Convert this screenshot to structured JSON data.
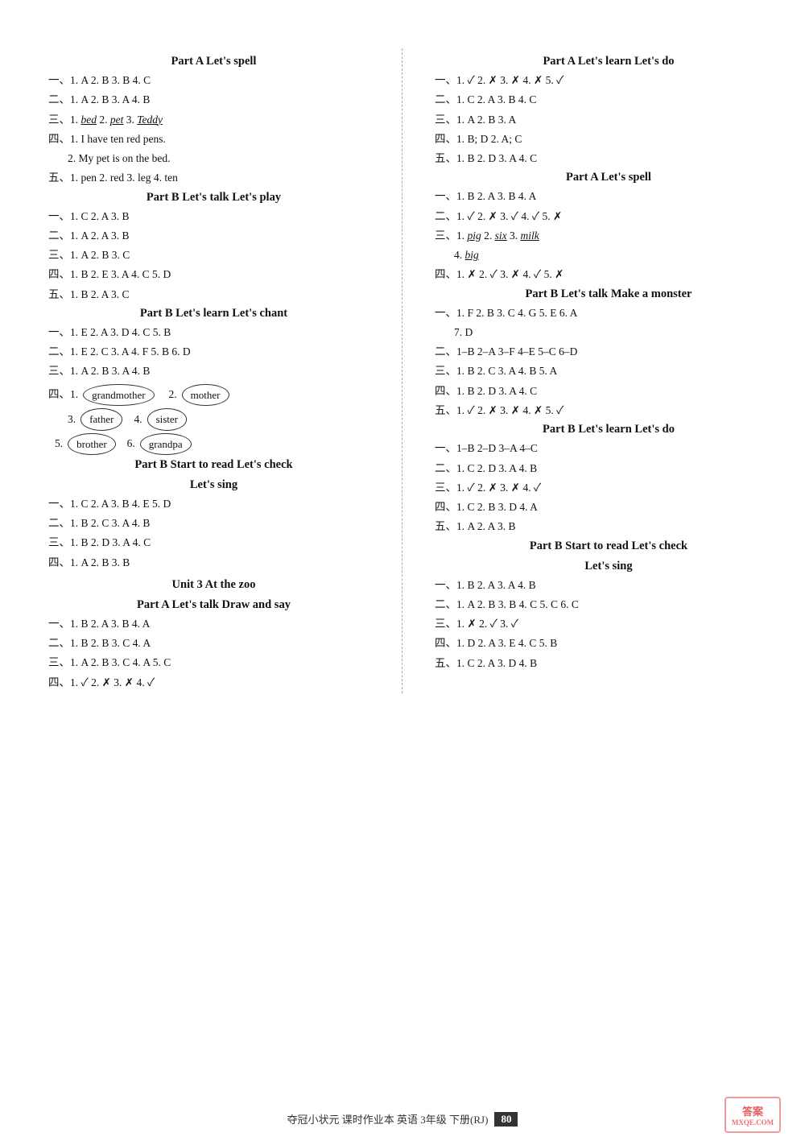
{
  "left": {
    "sections": [
      {
        "title": "Part A  Let's spell",
        "lines": [
          "一、1. A  2. B  3. B  4. C",
          "二、1. A  2. B  3. A  4. B",
          "三、1. <u>bed</u>  2. <u>pet</u>  3. <u>Teddy</u>",
          "四、1. I have ten red pens.",
          "  2. My pet is on the bed.",
          "五、1. pen  2. red  3. leg  4. ten"
        ]
      },
      {
        "title": "Part B  Let's talk  Let's play",
        "lines": [
          "一、1. C  2. A  3. B",
          "二、1. A  2. A  3. B",
          "三、1. A  2. B  3. C",
          "四、1. B  2. E  3. A  4. C  5. D",
          "五、1. B  2. A  3. C"
        ]
      },
      {
        "title": "Part B  Let's learn  Let's chant",
        "lines": [
          "一、1. E  2. A  3. D  4. C  5. B",
          "二、1. E  2. C  3. A  4. F  5. B  6. D",
          "三、1. A  2. B  3. A  4. B"
        ]
      },
      {
        "oval_section": true,
        "items": [
          {
            "num": "四、1.",
            "word": "grandmother"
          },
          {
            "num": "2.",
            "word": "mother"
          },
          {
            "num": "3.",
            "word": "father"
          },
          {
            "num": "4.",
            "word": "sister"
          },
          {
            "num": "5.",
            "word": "brother"
          },
          {
            "num": "6.",
            "word": "grandpa"
          }
        ]
      },
      {
        "title": "Part B  Start to read  Let's check",
        "subtitle": "Let's sing",
        "lines": [
          "一、1. C  2. A  3. B  4. E  5. D",
          "二、1. B  2. C  3. A  4. B",
          "三、1. B  2. D  3. A  4. C",
          "四、1. A  2. B  3. B"
        ]
      },
      {
        "title": "Unit 3  At the zoo",
        "subtitle2": "Part A  Let's talk  Draw and say",
        "lines": [
          "一、1. B  2. A  3. B  4. A",
          "二、1. B  2. B  3. C  4. A",
          "三、1. A  2. B  3. C  4. A  5. C",
          "四、1. ✓  2. ✗  3. ✗  4. ✓"
        ]
      }
    ]
  },
  "right": {
    "sections": [
      {
        "title": "Part A  Let's learn  Let's do",
        "lines": [
          "一、1. ✓  2. ✗  3. ✗  4. ✗  5. ✓",
          "二、1. C  2. A  3. B  4. C",
          "三、1. A  2. B  3. A",
          "四、1. B; D  2. A; C",
          "五、1. B  2. D  3. A  4. C"
        ]
      },
      {
        "title": "Part A  Let's spell",
        "lines": [
          "一、1. B  2. A  3. B  4. A",
          "二、1. ✓  2. ✗  3. ✓  4. ✓  5. ✗",
          "三、1. <u>pig</u>  2. <u>six</u>  3. <u>milk</u>",
          "  4. <u>big</u>",
          "四、1. ✗  2. ✓  3. ✗  4. ✓  5. ✗"
        ]
      },
      {
        "title": "Part B  Let's talk  Make a monster",
        "lines": [
          "一、1. F  2. B  3. C  4. G  5. E  6. A  7. D",
          "二、1–B  2–A  3–F  4–E  5–C  6–D",
          "三、1. B  2. C  3. A  4. B  5. A",
          "四、1. B  2. D  3. A  4. C",
          "五、1. ✓  2. ✗  3. ✗  4. ✗  5. ✓"
        ]
      },
      {
        "title": "Part B  Let's learn  Let's do",
        "lines": [
          "一、1–B  2–D  3–A  4–C",
          "二、1. C  2. D  3. A  4. B",
          "三、1. ✓  2. ✗  3. ✗  4. ✓",
          "四、1. C  2. B  3. D  4. A",
          "五、1. A  2. A  3. B"
        ]
      },
      {
        "title": "Part B  Start to read  Let's check",
        "subtitle": "Let's sing",
        "lines": [
          "一、1. B  2. A  3. A  4. B",
          "二、1. A  2. B  3. B  4. C  5. C  6. C",
          "三、1. ✗  2. ✓  3. ✓",
          "四、1. D  2. A  3. E  4. C  5. B",
          "五、1. C  2. A  3. D  4. B"
        ]
      }
    ]
  },
  "footer": {
    "text": "夺冠小状元  课时作业本  英语  3年级  下册(RJ)",
    "page_num": "80",
    "stamp_line1": "答案",
    "stamp_line2": "MXQE.COM"
  }
}
